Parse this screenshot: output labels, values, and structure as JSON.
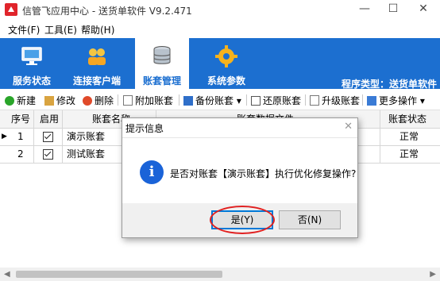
{
  "window": {
    "title": "信管飞应用中心 - 送货单软件 V9.2.471",
    "controls": [
      "—",
      "☐",
      "✕"
    ]
  },
  "menu": [
    "文件(F)",
    "工具(E)",
    "帮助(H)"
  ],
  "nav": {
    "tabs": [
      {
        "label": "服务状态",
        "icon": "monitor-icon"
      },
      {
        "label": "连接客户端",
        "icon": "users-icon"
      },
      {
        "label": "账套管理",
        "icon": "database-icon",
        "active": true
      },
      {
        "label": "系统参数",
        "icon": "gear-icon"
      }
    ],
    "program_type": "程序类型：送货单软件"
  },
  "toolbar": {
    "items": [
      "新建",
      "修改",
      "删除",
      "附加账套",
      "备份账套",
      "还原账套",
      "升级账套",
      "更多操作"
    ]
  },
  "table": {
    "headers": [
      "序号",
      "启用",
      "账套名称",
      "账套数据文件",
      "账套状态"
    ],
    "rows": [
      {
        "index": "1",
        "enabled": true,
        "name": "演示账套",
        "status": "正常"
      },
      {
        "index": "2",
        "enabled": true,
        "name": "测试账套",
        "status": "正常"
      }
    ]
  },
  "dialog": {
    "title": "提示信息",
    "message": "是否对账套【演示账套】执行优化修复操作?",
    "yes_label": "是(Y)",
    "no_label": "否(N)"
  },
  "colors": {
    "nav_blue": "#1c6fd0",
    "annotation_red": "#e02020"
  }
}
